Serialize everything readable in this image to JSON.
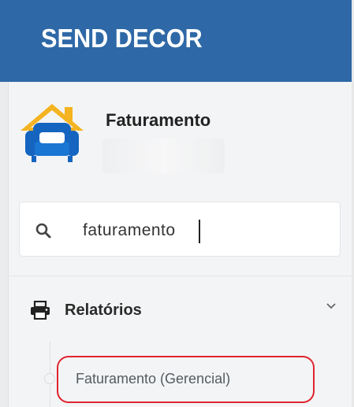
{
  "header": {
    "app_title": "SEND DECOR"
  },
  "user": {
    "name": "Faturamento",
    "logo_icon": "sofa-house-logo-icon"
  },
  "search": {
    "icon": "search-icon",
    "value": "faturamento"
  },
  "menu": {
    "group": {
      "icon": "printer-icon",
      "label": "Relatórios",
      "expand_icon": "chevron-down-icon"
    },
    "items": [
      {
        "label": "Faturamento (Gerencial)",
        "highlight_color": "#e0242f"
      }
    ]
  },
  "colors": {
    "header_bg": "#2e68a6",
    "sidebar_bg": "#f3f4f5",
    "logo_roof": "#f4b321",
    "logo_sofa": "#1565c0"
  }
}
